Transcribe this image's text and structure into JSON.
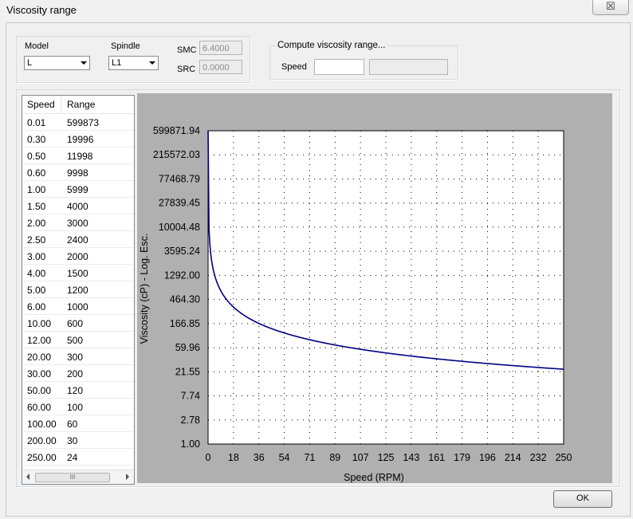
{
  "window": {
    "title": "Viscosity range",
    "close_glyph": "☒"
  },
  "settings": {
    "model_label": "Model",
    "model_value": "L",
    "spindle_label": "Spindle",
    "spindle_value": "L1",
    "smc_label": "SMC",
    "smc_value": "6.4000",
    "src_label": "SRC",
    "src_value": "0.0000"
  },
  "compute": {
    "group_label": "Compute viscosity range...",
    "speed_label": "Speed",
    "speed_value": "",
    "result_value": ""
  },
  "table": {
    "headers": [
      "Speed",
      "Range"
    ],
    "rows": [
      [
        "0.01",
        "599873"
      ],
      [
        "0.30",
        "19996"
      ],
      [
        "0.50",
        "11998"
      ],
      [
        "0.60",
        "9998"
      ],
      [
        "1.00",
        "5999"
      ],
      [
        "1.50",
        "4000"
      ],
      [
        "2.00",
        "3000"
      ],
      [
        "2.50",
        "2400"
      ],
      [
        "3.00",
        "2000"
      ],
      [
        "4.00",
        "1500"
      ],
      [
        "5.00",
        "1200"
      ],
      [
        "6.00",
        "1000"
      ],
      [
        "10.00",
        "600"
      ],
      [
        "12.00",
        "500"
      ],
      [
        "20.00",
        "300"
      ],
      [
        "30.00",
        "200"
      ],
      [
        "50.00",
        "120"
      ],
      [
        "60.00",
        "100"
      ],
      [
        "100.00",
        "60"
      ],
      [
        "200.00",
        "30"
      ],
      [
        "250.00",
        "24"
      ]
    ],
    "scroll_thumb_glyph": "III"
  },
  "chart_data": {
    "type": "line",
    "xlabel": "Speed (RPM)",
    "ylabel": "Viscosity (cP) - Log. Esc.",
    "x_ticks": [
      "0",
      "18",
      "36",
      "54",
      "71",
      "89",
      "107",
      "125",
      "143",
      "161",
      "179",
      "196",
      "214",
      "232",
      "250"
    ],
    "y_ticks": [
      "1.00",
      "2.78",
      "7.74",
      "21.55",
      "59.96",
      "166.85",
      "464.30",
      "1292.00",
      "3595.24",
      "10004.48",
      "27839.45",
      "77468.79",
      "215572.03",
      "599871.94"
    ],
    "xlim": [
      0,
      250
    ],
    "ylim": [
      1.0,
      599871.94
    ],
    "y_scale": "log",
    "grid": true,
    "series_color": "#000080",
    "series": [
      {
        "x": [
          0.01,
          0.3,
          0.5,
          0.6,
          1,
          1.5,
          2,
          2.5,
          3,
          4,
          5,
          6,
          10,
          12,
          20,
          30,
          50,
          60,
          100,
          200,
          250
        ],
        "y": [
          599873,
          19996,
          11998,
          9998,
          5999,
          4000,
          3000,
          2400,
          2000,
          1500,
          1200,
          1000,
          600,
          500,
          300,
          200,
          120,
          100,
          60,
          30,
          24
        ]
      }
    ]
  },
  "ok_button": {
    "label": "OK"
  }
}
